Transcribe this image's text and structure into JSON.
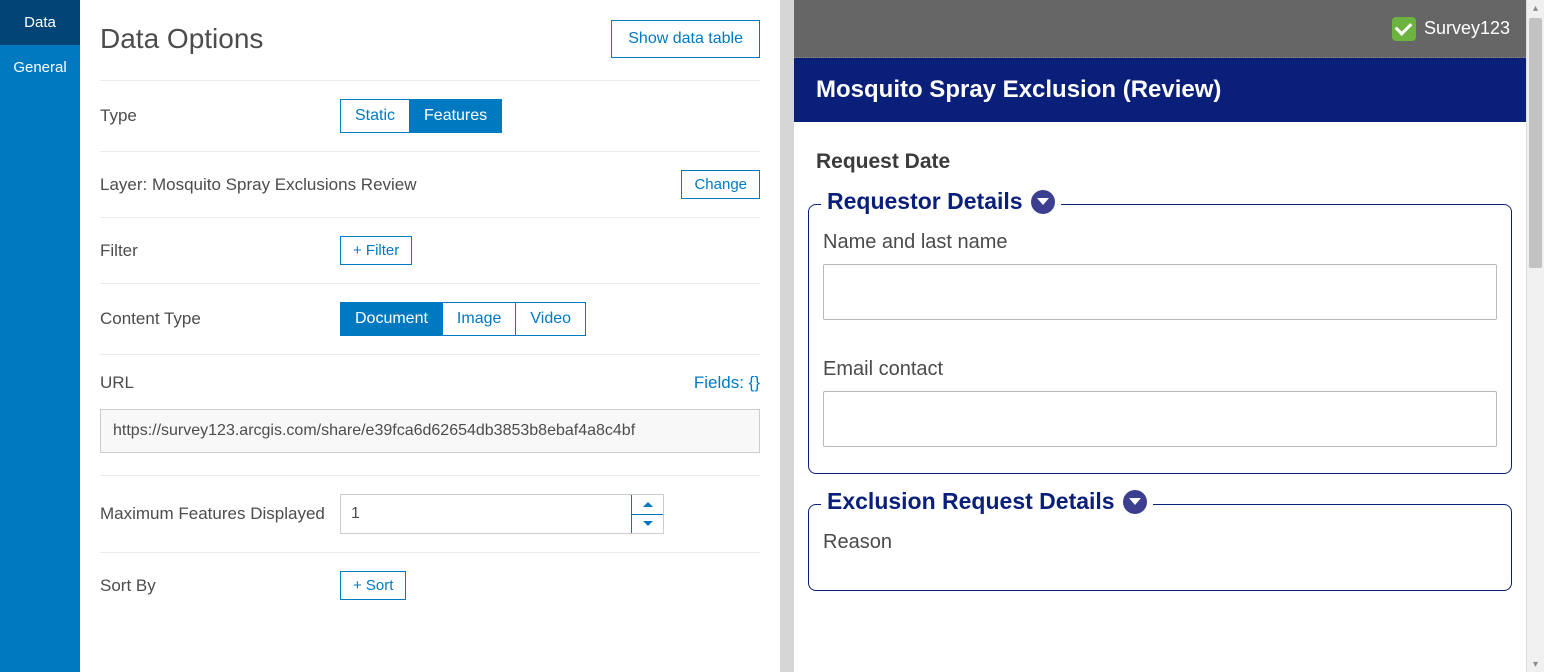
{
  "rail": {
    "tabs": [
      {
        "label": "Data",
        "active": true
      },
      {
        "label": "General",
        "active": false
      }
    ]
  },
  "config": {
    "title": "Data Options",
    "show_data_table": "Show data table",
    "type_label": "Type",
    "type_options": {
      "static": "Static",
      "features": "Features",
      "selected": "features"
    },
    "layer_label": "Layer: Mosquito Spray Exclusions Review",
    "change": "Change",
    "filter_label": "Filter",
    "filter_btn": "+ Filter",
    "content_type_label": "Content Type",
    "content_options": {
      "document": "Document",
      "image": "Image",
      "video": "Video",
      "selected": "document"
    },
    "url_label": "URL",
    "fields_link": "Fields: {}",
    "url_value": "https://survey123.arcgis.com/share/e39fca6d62654db3853b8ebaf4a8c4bf",
    "max_label": "Maximum Features Displayed",
    "max_value": "1",
    "sort_label": "Sort By",
    "sort_btn": "+ Sort"
  },
  "preview": {
    "brand": "Survey123",
    "survey_title": "Mosquito Spray Exclusion (Review)",
    "request_date_label": "Request Date",
    "group1": {
      "legend": "Requestor Details",
      "name_label": "Name and last name",
      "email_label": "Email contact"
    },
    "group2": {
      "legend": "Exclusion Request Details",
      "reason_label": "Reason"
    }
  }
}
